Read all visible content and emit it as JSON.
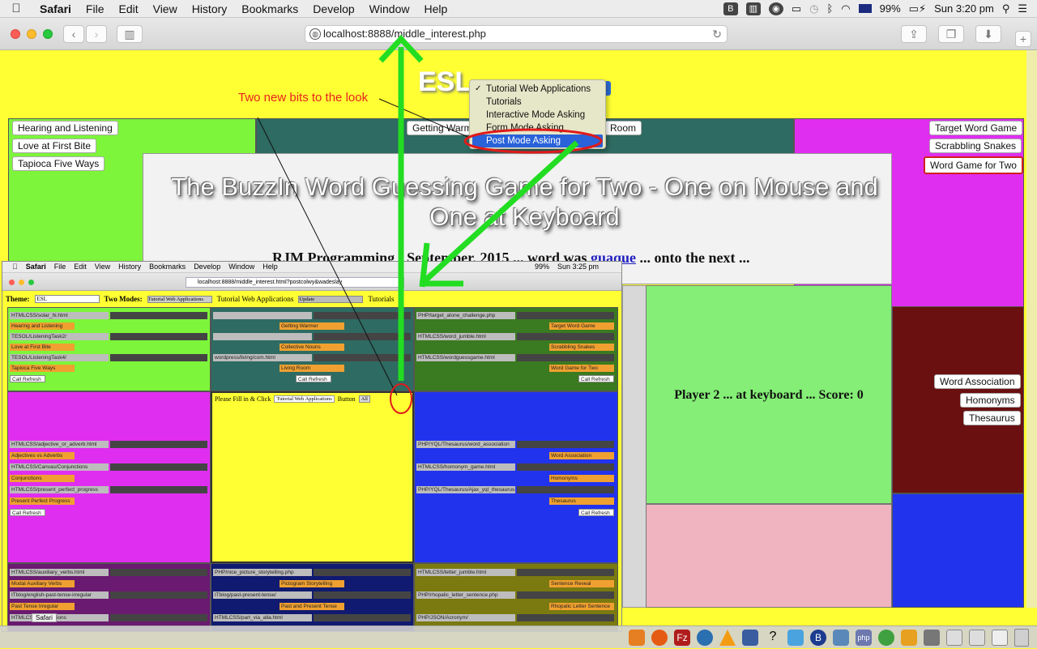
{
  "menubar": {
    "apple": "",
    "app": "Safari",
    "items": [
      "File",
      "Edit",
      "View",
      "History",
      "Bookmarks",
      "Develop",
      "Window",
      "Help"
    ],
    "battery": "99%",
    "clock": "Sun 3:20 pm"
  },
  "toolbar": {
    "url": "localhost:8888/middle_interest.php"
  },
  "page": {
    "header_partial": "ESL",
    "annotation": "Two new bits to the look",
    "left_buttons": [
      "Hearing and Listening",
      "Love at First Bite",
      "Tapioca Five Ways"
    ],
    "center_button_partial_left": "Getting Warm",
    "center_button_partial_right": "Room",
    "right_buttons": [
      "Target Word Game",
      "Scrabbling Snakes",
      "Word Game for Two"
    ],
    "game_title": "The BuzzIn Word Guessing Game for Two - One on Mouse and One at Keyboard",
    "credit_prefix": "RJM Programming - September, 2015 ... word was ",
    "credit_word": "guaque",
    "credit_suffix": " ... onto the next ...",
    "player_status": "Player 2 ... at keyboard ... Score: 0",
    "word_buttons": [
      "Word Association",
      "Homonyms",
      "Thesaurus"
    ]
  },
  "dropdown": {
    "options": [
      {
        "label": "Tutorial Web Applications",
        "checked": true,
        "selected": false
      },
      {
        "label": "Tutorials",
        "checked": false,
        "selected": false
      },
      {
        "label": "Interactive Mode Asking",
        "checked": false,
        "selected": false
      },
      {
        "label": "Form Mode Asking",
        "checked": false,
        "selected": false
      },
      {
        "label": "Post Mode Asking",
        "checked": false,
        "selected": true
      }
    ]
  },
  "inset": {
    "menubar": {
      "app": "Safari",
      "items": [
        "File",
        "Edit",
        "View",
        "History",
        "Bookmarks",
        "Develop",
        "Window",
        "Help"
      ],
      "battery": "99%",
      "clock": "Sun 3:25 pm"
    },
    "url": "localhost:8888/middle_interest.html?postcolwy&wadeslay",
    "theme_label": "Theme:",
    "theme_value": "ESL",
    "modes_label": "Two Modes:",
    "modes_value": "Tutorial Web Applications",
    "mode_text": "Tutorial Web Applications",
    "mode_box": "Update",
    "tutorials": "Tutorials",
    "fill_prompt": "Please Fill in & Click",
    "fill_select": "Tutorial Web Applications",
    "fill_button_label": "Button",
    "all_button": "All",
    "cells": {
      "c1": [
        "HTMLCSS/solar_hi.html",
        "Hearing and Listening",
        "TESOL/ListeningTask2/",
        "Love at First Bite",
        "TESOL/ListeningTask4/",
        "Tapioca Five Ways",
        "Call Refresh"
      ],
      "c2": [
        "Getting Warmer",
        "Collective Nouns",
        "wordpress/living/com.html",
        "Living Room",
        "Call Refresh"
      ],
      "c3": [
        "PHP/target_alone_challenge.php",
        "Target Word Game",
        "HTMLCSS/word_jumble.html",
        "Scrabbling Snakes",
        "HTMLCSS/wordguessgame.html",
        "Word Game for Two",
        "Call Refresh"
      ],
      "c4": [
        "HTMLCSS/adjective_or_adverb.html",
        "Adjectives vs Adverbs",
        "HTMLCSS/Canvas/Conjunctions",
        "Conjunctions",
        "HTMLCSS/present_perfect_progress",
        "Present Perfect Progress",
        "Call Refresh"
      ],
      "c6": [
        "PHP/YQL/Thesaurus/word_association",
        "Word Association",
        "HTMLCSS/homonym_game.html",
        "Homonyms",
        "PHP/YQL/Thesaurus/Ajax_yql_thesaurus",
        "Thesaurus",
        "Call Refresh"
      ],
      "c7": [
        "HTMLCSS/auxiliary_verbs.html",
        "Modal Auxiliary Verbs",
        "ITblog/english-past-tense-irregular",
        "Past Tense Irregular",
        "HTMLCSS/prepositions"
      ],
      "c8": [
        "PHP/nice_picture_storytelling.php",
        "Pictogram Storytelling",
        "ITblog/past-present-tense/",
        "Past and Present Tense",
        "HTMLCSS/part_via_alla.html"
      ],
      "c9": [
        "HTMLCSS/letter_jumble.html",
        "Sentence Reveal",
        "PHP/rhopalic_letter_sentence.php",
        "Rhopalic Letter Sentence",
        "PHP/JSON/Acronym/"
      ]
    },
    "dock_label": "Safari"
  }
}
